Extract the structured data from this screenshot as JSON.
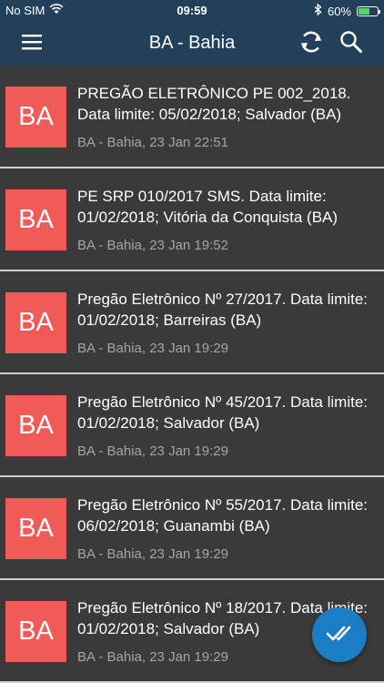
{
  "status_bar": {
    "carrier": "No SIM",
    "time": "09:59",
    "battery": "60%",
    "battery_level": 0.6
  },
  "header": {
    "title": "BA - Bahia",
    "icons": [
      "menu-icon",
      "sync-icon",
      "search-icon"
    ]
  },
  "items": [
    {
      "avatar": "BA",
      "title": "PREGÃO ELETRÔNICO PE 002_2018. Data limite: 05/02/2018; Salvador (BA)",
      "meta": "BA - Bahia, 23 Jan 22:51"
    },
    {
      "avatar": "BA",
      "title": "PE SRP 010/2017 SMS. Data limite: 01/02/2018; Vitória da Conquista (BA)",
      "meta": "BA - Bahia, 23 Jan 19:52"
    },
    {
      "avatar": "BA",
      "title": "Pregão Eletrônico Nº 27/2017. Data limite: 01/02/2018; Barreiras (BA)",
      "meta": "BA - Bahia, 23 Jan 19:29"
    },
    {
      "avatar": "BA",
      "title": "Pregão Eletrônico Nº 45/2017. Data limite: 01/02/2018; Salvador (BA)",
      "meta": "BA - Bahia, 23 Jan 19:29"
    },
    {
      "avatar": "BA",
      "title": "Pregão Eletrônico Nº 55/2017. Data limite: 06/02/2018; Guanambi (BA)",
      "meta": "BA - Bahia, 23 Jan 19:29"
    },
    {
      "avatar": "BA",
      "title": "Pregão Eletrônico Nº 18/2017. Data limite: 01/02/2018; Salvador (BA)",
      "meta": "BA - Bahia, 23 Jan 19:29"
    }
  ],
  "fab": {
    "icon": "double-check-icon"
  },
  "colors": {
    "header_bg": "#22405a",
    "list_bg": "#3a3a3a",
    "avatar_bg": "#f05a57",
    "fab_bg": "#1b7ec4",
    "meta_text": "#a5a5a5",
    "battery_green": "#4cd964"
  }
}
